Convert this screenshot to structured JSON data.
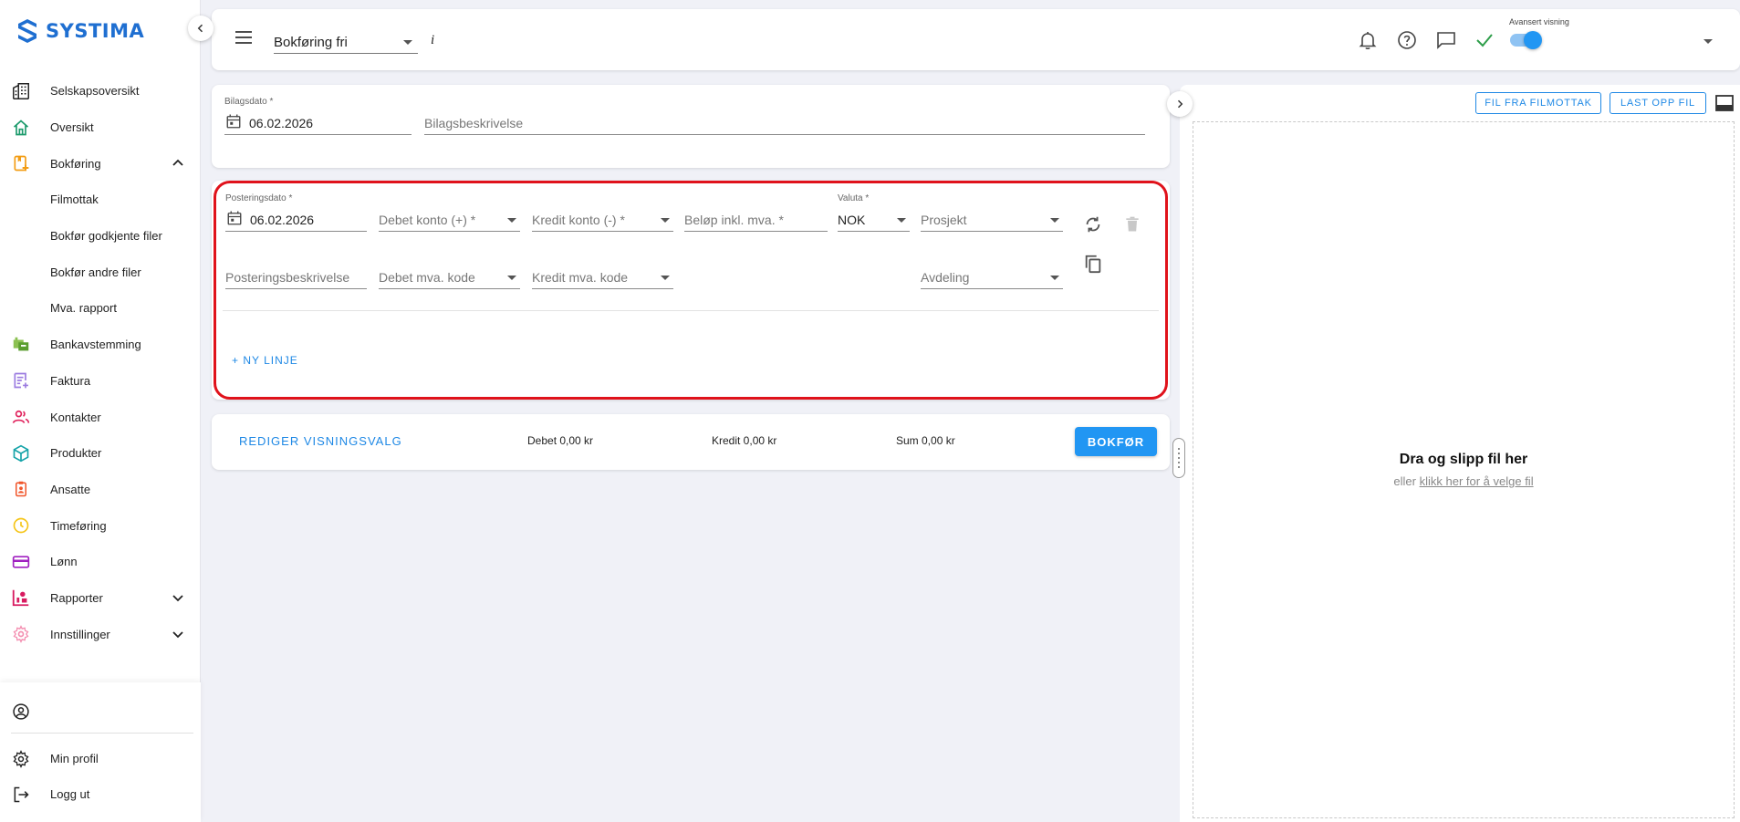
{
  "app": {
    "logo_text": "SYSTIMA",
    "brand_color": "#1f6fd1",
    "accent_color": "#2196f3",
    "highlight_color": "#e0121b"
  },
  "sidebar": {
    "items": [
      {
        "label": "Selskapsoversikt",
        "icon": "buildings-icon"
      },
      {
        "label": "Oversikt",
        "icon": "home-icon"
      },
      {
        "label": "Bokføring",
        "icon": "bookkeeping-icon",
        "expanded": true
      },
      {
        "label": "Filmottak"
      },
      {
        "label": "Bokfør godkjente filer"
      },
      {
        "label": "Bokfør andre filer"
      },
      {
        "label": "Mva. rapport"
      },
      {
        "label": "Bankavstemming",
        "icon": "bank-icon"
      },
      {
        "label": "Faktura",
        "icon": "invoice-icon"
      },
      {
        "label": "Kontakter",
        "icon": "contacts-icon"
      },
      {
        "label": "Produkter",
        "icon": "product-box-icon"
      },
      {
        "label": "Ansatte",
        "icon": "employee-badge-icon"
      },
      {
        "label": "Timeføring",
        "icon": "clock-icon"
      },
      {
        "label": "Lønn",
        "icon": "payment-card-icon"
      },
      {
        "label": "Rapporter",
        "icon": "report-icon",
        "expanded": false
      },
      {
        "label": "Innstillinger",
        "icon": "settings-icon",
        "expanded": false
      }
    ],
    "bottom": {
      "profile_label": "Min profil",
      "logout_label": "Logg ut"
    }
  },
  "header": {
    "page_select": "Bokføring fri",
    "info_label": "i",
    "advanced_view_label": "Avansert visning",
    "advanced_view_on": true
  },
  "voucher": {
    "date_label": "Bilagsdato *",
    "date_value": "06.02.2026",
    "description_placeholder": "Bilagsbeskrivelse"
  },
  "posting": {
    "date_label": "Posteringsdato *",
    "date_value": "06.02.2026",
    "debit_account_placeholder": "Debet konto (+) *",
    "credit_account_placeholder": "Kredit konto (-) *",
    "amount_placeholder": "Beløp inkl. mva. *",
    "currency_label": "Valuta *",
    "currency_value": "NOK",
    "project_placeholder": "Prosjekt",
    "description_placeholder": "Posteringsbeskrivelse",
    "debit_vat_placeholder": "Debet mva. kode",
    "credit_vat_placeholder": "Kredit mva. kode",
    "department_placeholder": "Avdeling",
    "new_line_label": "+ NY LINJE"
  },
  "footer": {
    "edit_view_label": "REDIGER VISNINGSVALG",
    "debit_total": "Debet 0,00 kr",
    "credit_total": "Kredit 0,00 kr",
    "sum_total": "Sum 0,00 kr",
    "post_button": "BOKFØR"
  },
  "file_panel": {
    "from_inbox_button": "FIL FRA FILMOTTAK",
    "upload_button": "LAST OPP FIL",
    "drop_title": "Dra og slipp fil her",
    "drop_or": "eller",
    "drop_link": "klikk her for å velge fil"
  }
}
